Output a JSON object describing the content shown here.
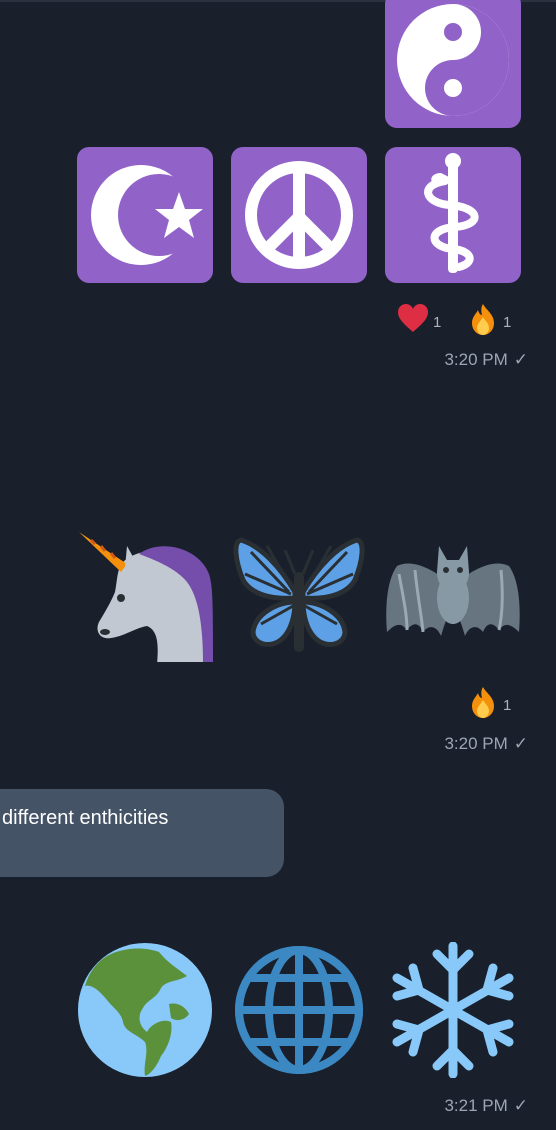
{
  "messages": [
    {
      "type": "emoji-sticker-group",
      "emojis": [
        "yin-yang",
        "star-and-crescent",
        "peace-symbol",
        "staff-of-aesculapius"
      ],
      "reactions": [
        {
          "icon": "red-heart",
          "count": "1"
        },
        {
          "icon": "fire",
          "count": "1"
        }
      ],
      "time": "3:20 PM"
    },
    {
      "type": "emoji-sticker-group",
      "emojis": [
        "unicorn",
        "butterfly",
        "bat"
      ],
      "reactions": [
        {
          "icon": "fire",
          "count": "1"
        }
      ],
      "time": "3:20 PM"
    },
    {
      "type": "text",
      "text": "different enthicities"
    },
    {
      "type": "emoji-sticker-group",
      "emojis": [
        "globe-americas",
        "globe-with-meridians",
        "snowflake"
      ],
      "time": "3:21 PM"
    }
  ],
  "status": {
    "check": "✓"
  },
  "colors": {
    "background": "#19202b",
    "symbol_tile": "#9163c9",
    "bubble": "#445366"
  }
}
